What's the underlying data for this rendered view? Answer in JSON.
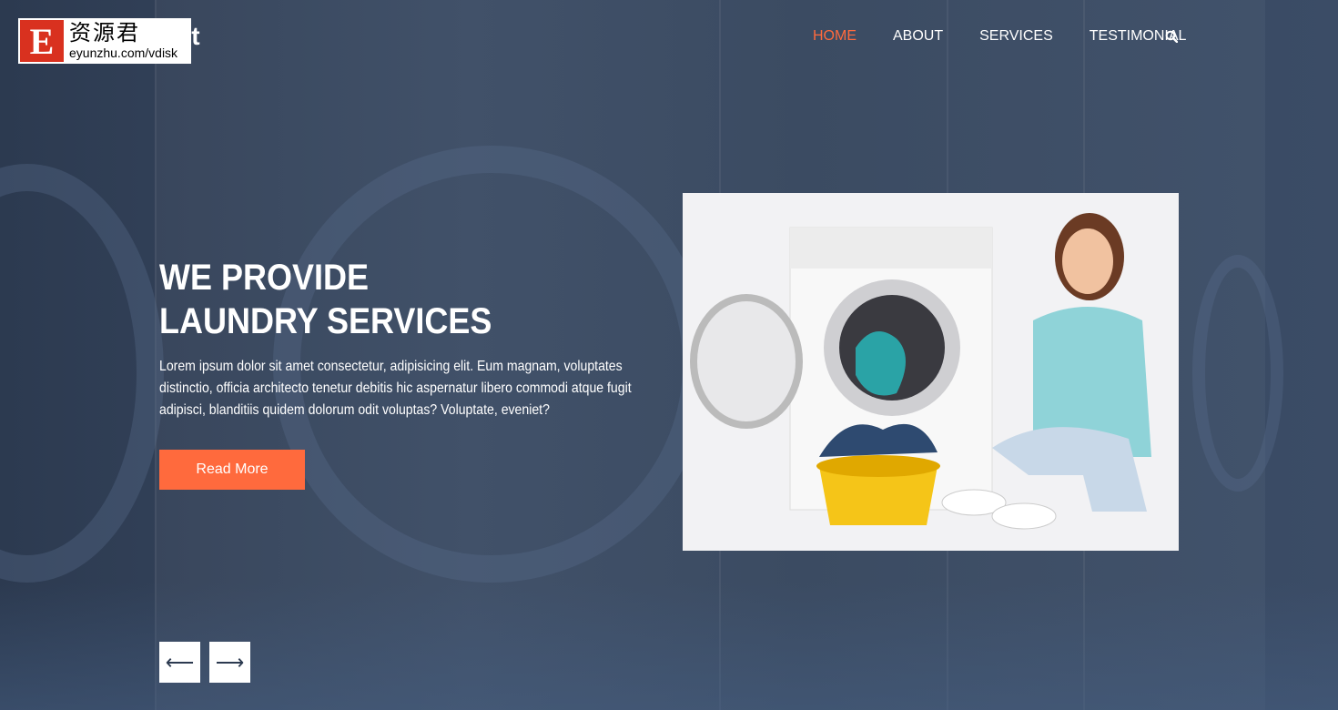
{
  "logo": {
    "visible_text": "pot"
  },
  "watermark": {
    "mark": "E",
    "cn": "资源君",
    "url": "eyunzhu.com/vdisk"
  },
  "nav": {
    "items": [
      {
        "label": "HOME",
        "active": true
      },
      {
        "label": "ABOUT"
      },
      {
        "label": "SERVICES"
      },
      {
        "label": "TESTIMONIAL"
      }
    ],
    "search_icon": "search-icon"
  },
  "hero": {
    "title_line1": "WE PROVIDE",
    "title_line2": "LAUNDRY SERVICES",
    "description": "Lorem ipsum dolor sit amet consectetur, adipisicing elit. Eum magnam, voluptates distinctio, officia architecto tenetur debitis hic aspernatur libero commodi atque fugit adipisci, blanditiis quidem dolorum odit voluptas? Voluptate, eveniet?",
    "button": "Read More",
    "prev": "⟵",
    "next": "⟶"
  },
  "colors": {
    "accent": "#ff6a3d",
    "overlay": "#2c3a50"
  }
}
